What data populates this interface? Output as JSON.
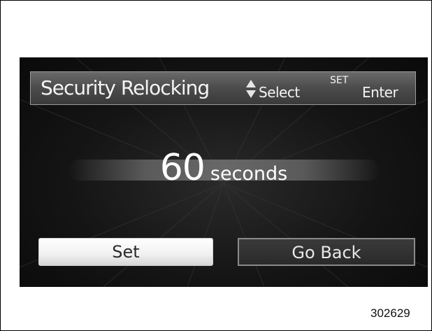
{
  "screen": {
    "header": {
      "title": "Security Relocking",
      "select_hint": "Select",
      "set_hint": "SET",
      "enter_hint": "Enter",
      "updown_icon": "up-down-arrows-icon"
    },
    "value": {
      "number": "60",
      "unit": "seconds"
    },
    "buttons": {
      "set_label": "Set",
      "back_label": "Go Back"
    },
    "colors": {
      "background": "#141414",
      "header": "#4b4b4b",
      "text": "#ffffff",
      "selected_button": "#f0f0f0"
    }
  },
  "figure_id": "302629"
}
